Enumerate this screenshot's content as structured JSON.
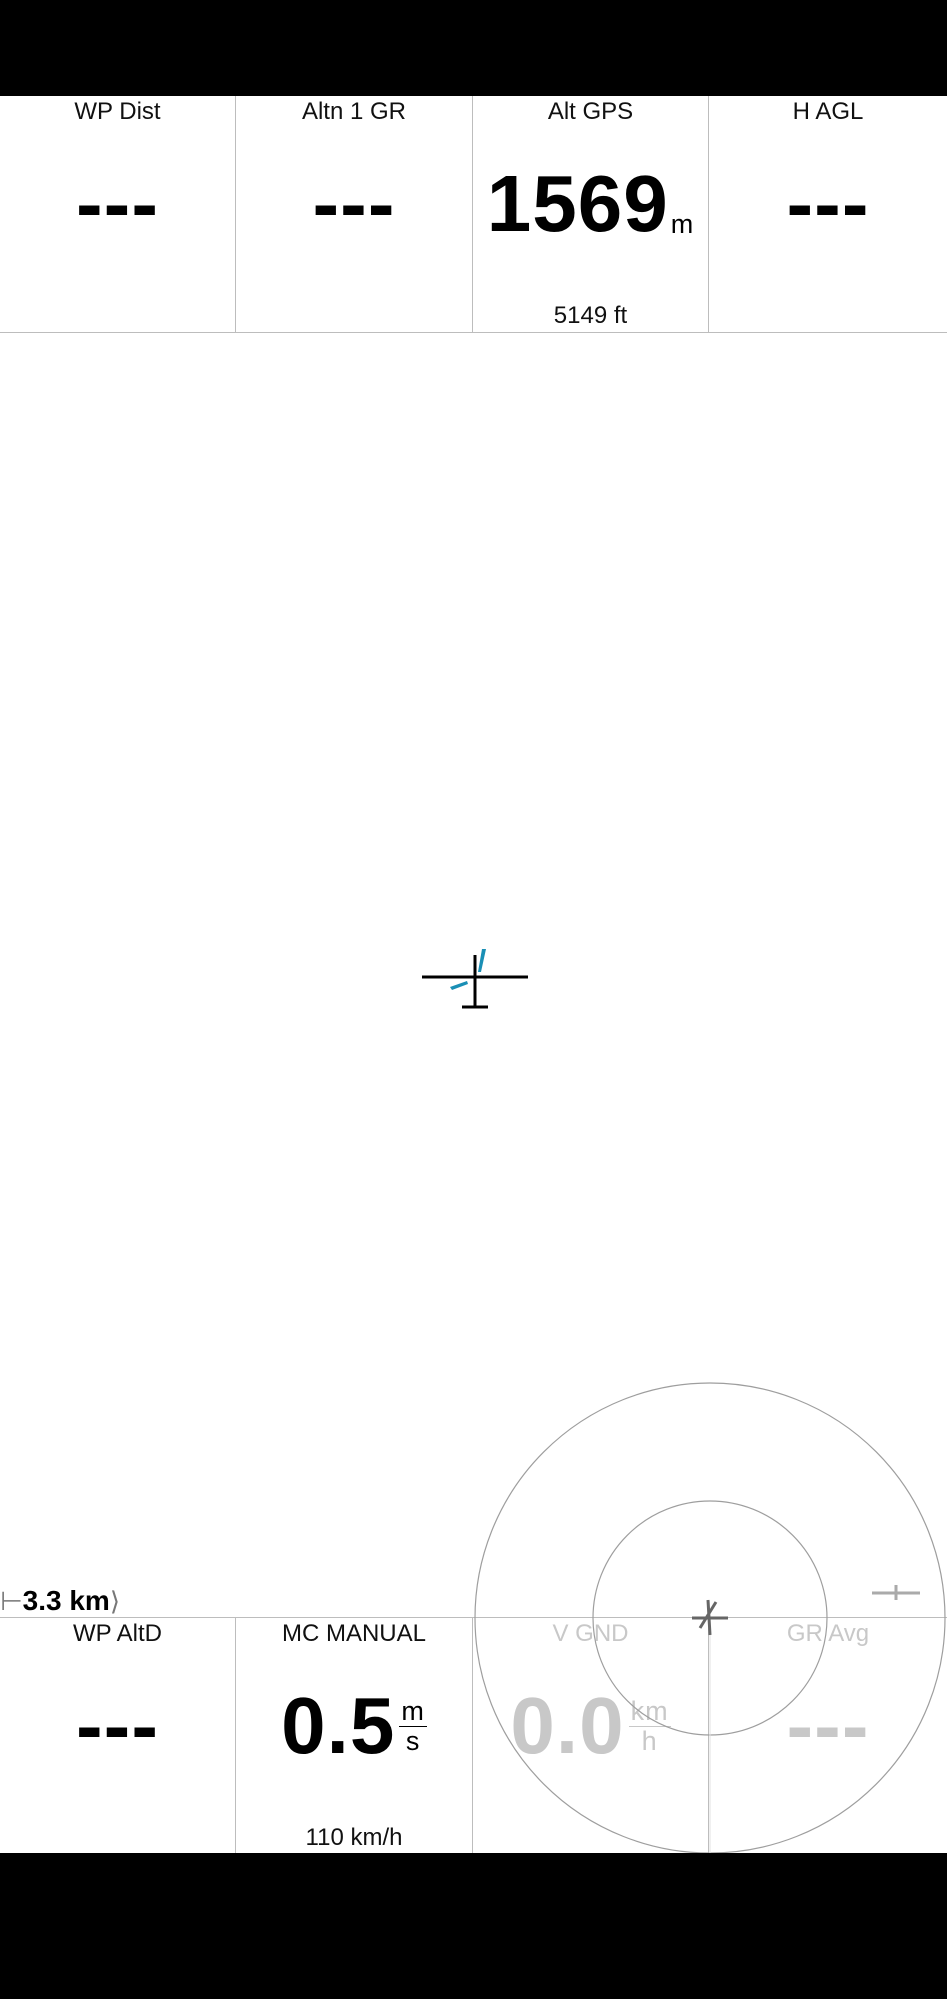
{
  "top_infoboxes": [
    {
      "title": "WP Dist",
      "value": "---",
      "unit": "",
      "comment": ""
    },
    {
      "title": "Altn 1 GR",
      "value": "---",
      "unit": "",
      "comment": ""
    },
    {
      "title": "Alt GPS",
      "value": "1569",
      "unit": "m",
      "comment": "5149 ft"
    },
    {
      "title": "H AGL",
      "value": "---",
      "unit": "",
      "comment": ""
    }
  ],
  "bottom_infoboxes": [
    {
      "title": "WP AltD",
      "value": "---",
      "comment": ""
    },
    {
      "title": "MC MANUAL",
      "value": "0.5",
      "unit_num": "m",
      "unit_den": "s",
      "comment": "110 km/h"
    },
    {
      "title": "V GND",
      "value": "0.0",
      "unit_num": "km",
      "unit_den": "h",
      "comment": ""
    },
    {
      "title": "GR Avg",
      "value": "---",
      "comment": ""
    }
  ],
  "map": {
    "scale_label": "3.3 km"
  },
  "colors": {
    "statusbar": "#000000",
    "accent_wind": "#1a8fb5",
    "dimmed_text": "#c8c8c8"
  }
}
